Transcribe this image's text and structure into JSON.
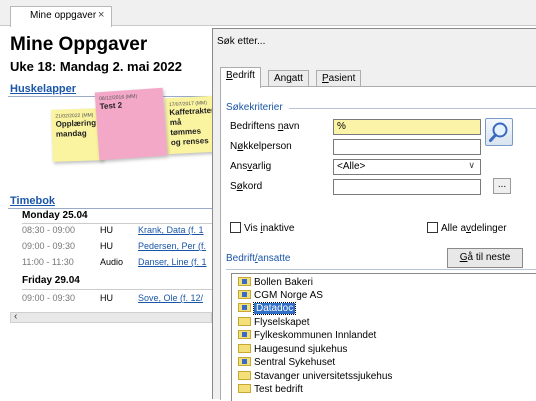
{
  "doc_tab": {
    "label": "Mine oppgaver",
    "close": "×"
  },
  "page": {
    "title": "Mine Oppgaver",
    "subtitle": "Uke 18: Mandag 2. mai 2022",
    "notes_link": "Huskelapper",
    "schedule_link": "Timebok"
  },
  "notes": [
    {
      "date": "21/02/2022 (MM)",
      "text": "Opplæring mandag",
      "color": "#faf3a0"
    },
    {
      "date": "06/12/2016 (MM)",
      "text": "Test 2",
      "color": "#f4a8c8"
    },
    {
      "date": "17/07/2017 (MM)",
      "text": "Kaffetrakteren må tømmes og renses",
      "color": "#faf3a0"
    }
  ],
  "schedule": {
    "days": [
      {
        "label": "Monday 25.04",
        "rows": [
          {
            "time": "08:30 - 09:00",
            "type": "HU",
            "patient": "Krank, Data (f. 1"
          },
          {
            "time": "09:00 - 09:30",
            "type": "HU",
            "patient": "Pedersen, Per (f."
          },
          {
            "time": "11:00 - 11:30",
            "type": "Audio",
            "patient": "Danser, Line (f. 1"
          }
        ]
      },
      {
        "label": "Friday 29.04",
        "rows": [
          {
            "time": "09:00 - 09:30",
            "type": "HU",
            "patient": "Sove, Ole (f. 12/"
          }
        ]
      }
    ]
  },
  "scroll_arrow": "‹",
  "dialog": {
    "title": "Søk etter...",
    "tabs": [
      {
        "pre": "",
        "u": "B",
        "post": "edrift"
      },
      {
        "pre": "An",
        "u": "g",
        "post": "att"
      },
      {
        "pre": "",
        "u": "P",
        "post": "asient"
      }
    ],
    "criteria_label": "Søkekriterier",
    "fields": [
      {
        "pre": "Bedriftens ",
        "u": "n",
        "post": "avn",
        "value": "%"
      },
      {
        "pre": "N",
        "u": "ø",
        "post": "kkelperson",
        "value": ""
      },
      {
        "pre": "Ans",
        "u": "v",
        "post": "arlig",
        "value": "<Alle>"
      },
      {
        "pre": "S",
        "u": "ø",
        "post": "kord",
        "value": ""
      }
    ],
    "dots_label": "...",
    "show_inactive": {
      "pre": "Vis ",
      "u": "i",
      "post": "naktive"
    },
    "all_departments": {
      "pre": "Alle a",
      "u": "v",
      "post": "delinger"
    },
    "results_label": {
      "pre": "Bedrift",
      "u": "/",
      "post": "ansatte"
    },
    "next_button": {
      "pre": "",
      "u": "G",
      "post": "å til neste"
    },
    "results": [
      {
        "name": "Bollen Bakeri",
        "icon": "company-icon",
        "selected": false
      },
      {
        "name": "CGM Norge AS",
        "icon": "company-icon",
        "selected": false
      },
      {
        "name": "Datadoc",
        "icon": "company-icon",
        "selected": true
      },
      {
        "name": "Flyselskapet",
        "icon": "folder-icon",
        "selected": false
      },
      {
        "name": "Fylkeskommunen Innlandet",
        "icon": "company-icon",
        "selected": false
      },
      {
        "name": "Haugesund sjukehus",
        "icon": "folder-icon",
        "selected": false
      },
      {
        "name": "Sentral Sykehuset",
        "icon": "company-icon",
        "selected": false
      },
      {
        "name": "Stavanger universitetssjukehus",
        "icon": "folder-icon",
        "selected": false
      },
      {
        "name": "Test bedrift",
        "icon": "folder-icon",
        "selected": false
      }
    ]
  }
}
